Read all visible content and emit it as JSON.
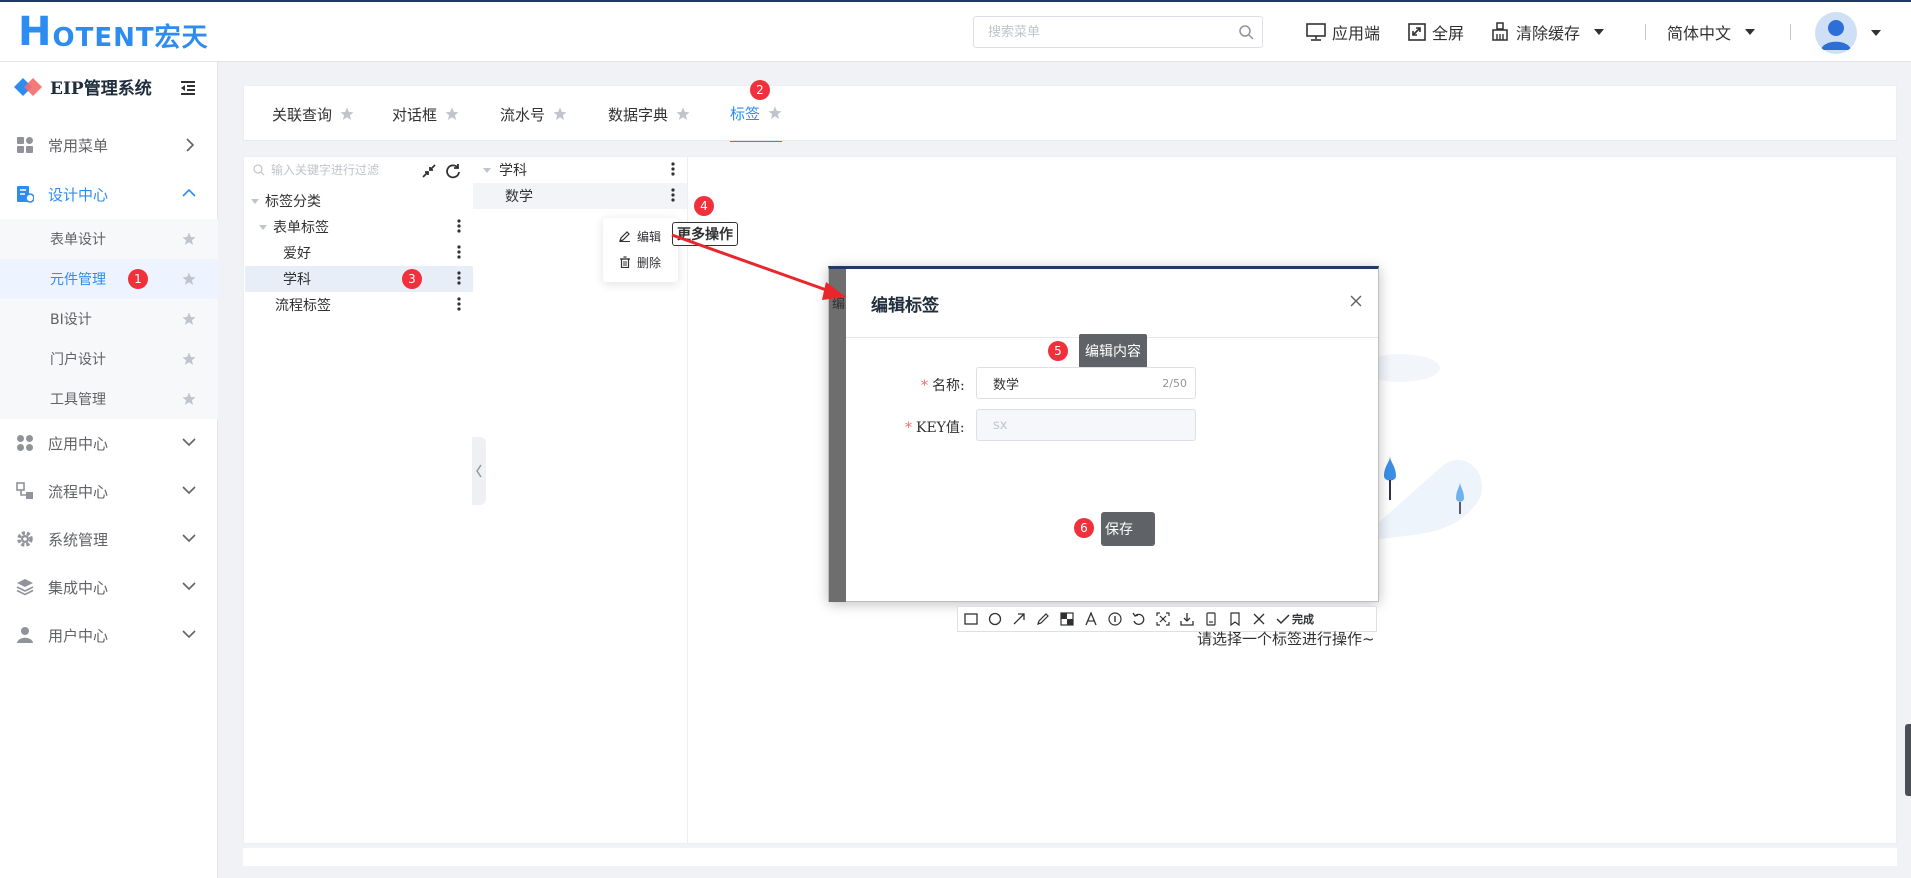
{
  "header": {
    "logo_text": "OTENT宏天",
    "logo_letter": "H",
    "search_placeholder": "搜索菜单",
    "app_label": "应用端",
    "fullscreen_label": "全屏",
    "clear_cache_label": "清除缓存",
    "language_label": "简体中文"
  },
  "sidebar": {
    "system_name": "EIP管理系统",
    "menu": [
      {
        "label": "常用菜单",
        "icon": "grid-icon",
        "state": "collapsed"
      },
      {
        "label": "设计中心",
        "icon": "design-icon",
        "state": "expanded",
        "active": true
      },
      {
        "label": "应用中心",
        "icon": "apps-icon",
        "state": "collapsed"
      },
      {
        "label": "流程中心",
        "icon": "flow-icon",
        "state": "collapsed"
      },
      {
        "label": "系统管理",
        "icon": "gear-icon",
        "state": "collapsed"
      },
      {
        "label": "集成中心",
        "icon": "layers-icon",
        "state": "collapsed"
      },
      {
        "label": "用户中心",
        "icon": "user-icon",
        "state": "collapsed"
      }
    ],
    "submenu": [
      {
        "label": "表单设计"
      },
      {
        "label": "元件管理",
        "active": true
      },
      {
        "label": "BI设计"
      },
      {
        "label": "门户设计"
      },
      {
        "label": "工具管理"
      }
    ]
  },
  "tabs": [
    {
      "label": "关联查询"
    },
    {
      "label": "对话框"
    },
    {
      "label": "流水号"
    },
    {
      "label": "数据字典"
    },
    {
      "label": "标签",
      "active": true
    }
  ],
  "left_tree": {
    "filter_placeholder": "输入关键字进行过滤",
    "nodes": [
      {
        "label": "标签分类",
        "level": 0
      },
      {
        "label": "表单标签",
        "level": 1
      },
      {
        "label": "爱好",
        "level": 2
      },
      {
        "label": "学科",
        "level": 2,
        "selected": true
      },
      {
        "label": "流程标签",
        "level": 1
      }
    ]
  },
  "mid_tree": {
    "nodes": [
      {
        "label": "学科",
        "level": 0
      },
      {
        "label": "数学",
        "level": 1
      }
    ]
  },
  "context_menu": {
    "edit": "编辑",
    "delete": "删除",
    "more_ops": "更多操作"
  },
  "dialog": {
    "title": "编辑标签",
    "left_fragment": "编",
    "name_label": "名称:",
    "name_value": "数学",
    "name_count": "2/50",
    "key_label": "KEY值:",
    "key_value": "sx",
    "edit_tip": "编辑内容",
    "save_label": "保存"
  },
  "annotation_toolbar": {
    "done_label": "完成"
  },
  "empty_hint": "请选择一个标签进行操作~",
  "steps": [
    "1",
    "2",
    "3",
    "4",
    "5",
    "6"
  ],
  "colors": {
    "accent": "#2d8cf0",
    "badge": "#f0303a",
    "arrow": "#e8262b",
    "navy": "#1f3a63"
  }
}
